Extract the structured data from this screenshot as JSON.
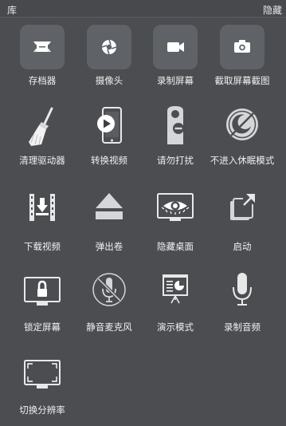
{
  "header": {
    "title": "库",
    "hide_label": "隐藏"
  },
  "items": [
    {
      "label": "存档器",
      "icon": "archive-box-icon"
    },
    {
      "label": "摄像头",
      "icon": "aperture-icon"
    },
    {
      "label": "录制屏幕",
      "icon": "video-camera-icon"
    },
    {
      "label": "截取屏幕截图",
      "icon": "camera-icon"
    },
    {
      "label": "清理驱动器",
      "icon": "broom-icon"
    },
    {
      "label": "转换视频",
      "icon": "phone-play-icon"
    },
    {
      "label": "请勿打扰",
      "icon": "door-hanger-icon"
    },
    {
      "label": "不进入休眠模式",
      "icon": "moon-icon"
    },
    {
      "label": "下载视频",
      "icon": "film-download-icon"
    },
    {
      "label": "弹出卷",
      "icon": "eject-icon"
    },
    {
      "label": "隐藏桌面",
      "icon": "eye-monitor-icon"
    },
    {
      "label": "启动",
      "icon": "launch-window-icon"
    },
    {
      "label": "锁定屏幕",
      "icon": "lock-monitor-icon"
    },
    {
      "label": "静音麦克风",
      "icon": "mute-microphone-icon"
    },
    {
      "label": "演示模式",
      "icon": "presentation-icon"
    },
    {
      "label": "录制音频",
      "icon": "microphone-icon"
    },
    {
      "label": "切换分辨率",
      "icon": "resolution-monitor-icon"
    }
  ]
}
